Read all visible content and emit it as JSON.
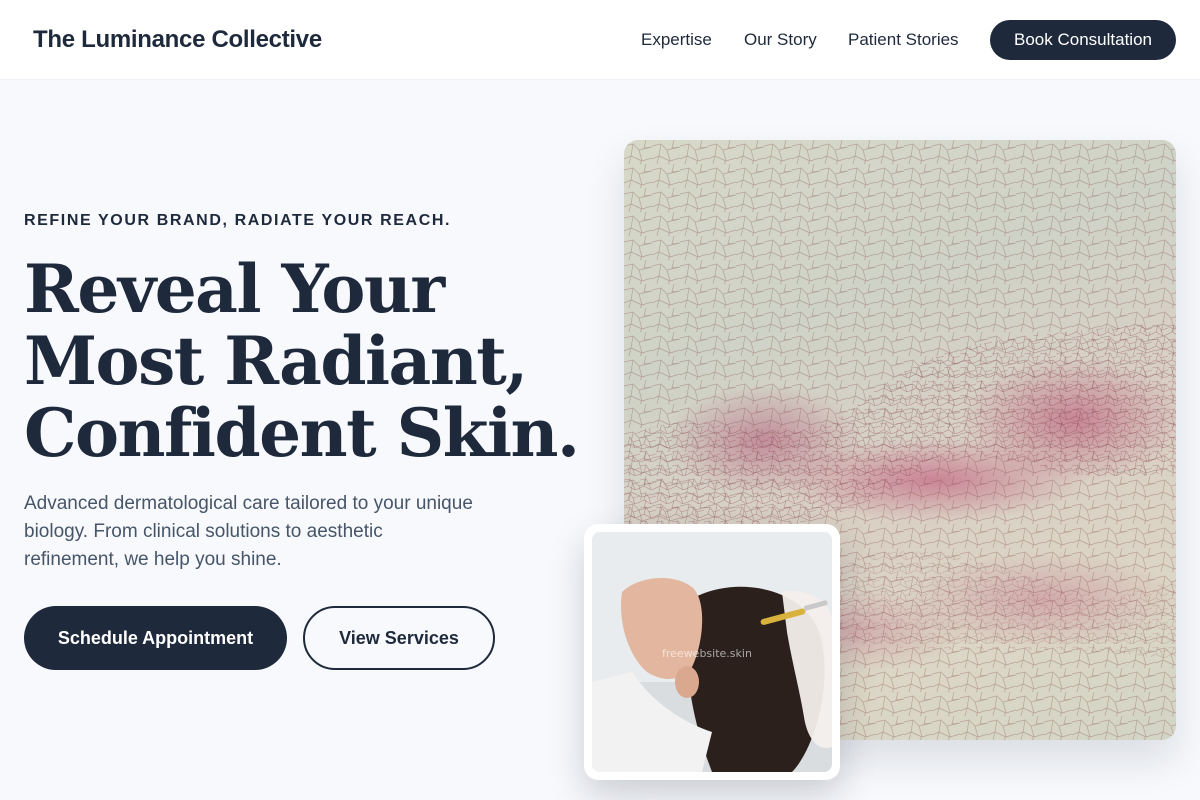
{
  "header": {
    "brand": "The Luminance Collective",
    "nav": [
      {
        "label": "Expertise"
      },
      {
        "label": "Our Story"
      },
      {
        "label": "Patient Stories"
      }
    ],
    "cta_label": "Book Consultation"
  },
  "hero": {
    "eyebrow": "REFINE YOUR BRAND, RADIATE YOUR REACH.",
    "headline_lines": [
      "Reveal Your",
      "Most Radiant,",
      "Confident Skin."
    ],
    "lead": "Advanced dermatological care tailored to your unique biology. From clinical solutions to aesthetic refinement, we help you shine.",
    "primary_button": "Schedule Appointment",
    "secondary_button": "View Services"
  },
  "images": {
    "main_image": "skin-texture-macro",
    "inset_image": "scalp-injection-treatment",
    "watermark": "freewebsite.skin"
  },
  "colors": {
    "primary": "#1e293b",
    "background": "#f7f9fc",
    "text_muted": "#475569",
    "accent_pink": "#b8466e"
  }
}
